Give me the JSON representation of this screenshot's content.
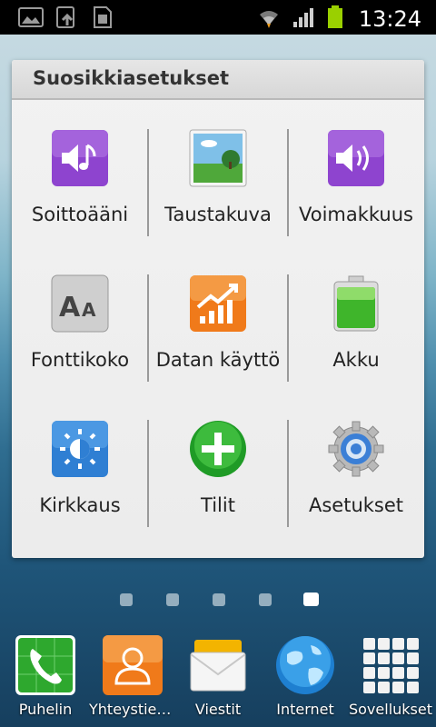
{
  "status_bar": {
    "time": "13:24",
    "icons": [
      "picture-icon",
      "upload-icon",
      "sim-card-icon",
      "wifi-icon",
      "signal-icon",
      "battery-icon"
    ]
  },
  "widget": {
    "title": "Suosikkiasetukset",
    "items": [
      {
        "label": "Soittoääni",
        "icon": "ringtone-icon"
      },
      {
        "label": "Taustakuva",
        "icon": "wallpaper-icon"
      },
      {
        "label": "Voimakkuus",
        "icon": "volume-icon"
      },
      {
        "label": "Fonttikoko",
        "icon": "font-size-icon"
      },
      {
        "label": "Datan käyttö",
        "icon": "data-usage-icon"
      },
      {
        "label": "Akku",
        "icon": "battery-icon"
      },
      {
        "label": "Kirkkaus",
        "icon": "brightness-icon"
      },
      {
        "label": "Tilit",
        "icon": "add-account-icon"
      },
      {
        "label": "Asetukset",
        "icon": "settings-gear-icon"
      }
    ]
  },
  "pages": {
    "count": 5,
    "active_index": 4
  },
  "dock": [
    {
      "label": "Puhelin",
      "icon": "phone-icon"
    },
    {
      "label": "Yhteystiedot",
      "icon": "contacts-icon"
    },
    {
      "label": "Viestit",
      "icon": "messages-icon"
    },
    {
      "label": "Internet",
      "icon": "internet-globe-icon"
    },
    {
      "label": "Sovellukset",
      "icon": "apps-grid-icon"
    }
  ],
  "colors": {
    "accent_purple": "#8a3fc9",
    "accent_orange": "#f07a1a",
    "accent_blue": "#2f7fd3",
    "accent_green": "#2aa12a"
  }
}
